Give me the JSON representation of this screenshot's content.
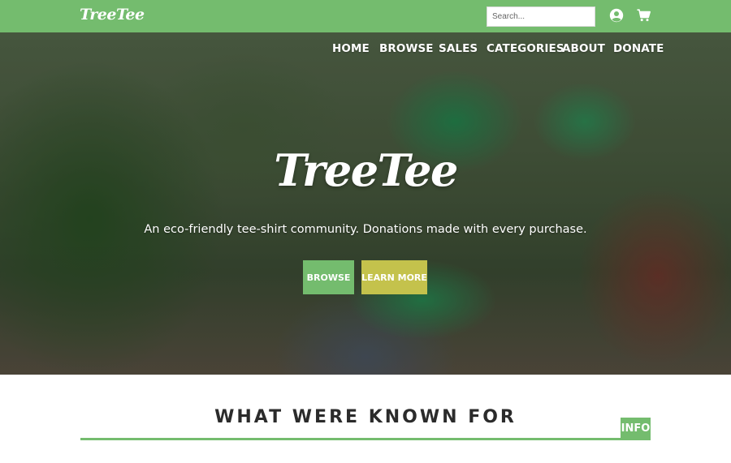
{
  "header": {
    "logo": "TreeTee",
    "search_placeholder": "Search...",
    "account_icon": "user-circle-icon",
    "cart_icon": "shopping-cart-icon"
  },
  "nav": {
    "items": [
      {
        "label": "HOME"
      },
      {
        "label": "BROWSE"
      },
      {
        "label": "SALES"
      },
      {
        "label": "CATEGORIES"
      },
      {
        "label": "ABOUT"
      },
      {
        "label": "DONATE"
      }
    ]
  },
  "hero": {
    "title": "TreeTee",
    "tagline": "An eco-friendly tee-shirt community. Donations made with every purchase.",
    "browse_label": "BROWSE",
    "learn_more_label": "LEARN MORE"
  },
  "section": {
    "heading": "WHAT WERE KNOWN FOR",
    "tab_label": "INFO"
  },
  "colors": {
    "brand_green": "#74bc6e",
    "accent_yellow": "#c4c24c",
    "heading_text": "#2b2b2b"
  }
}
